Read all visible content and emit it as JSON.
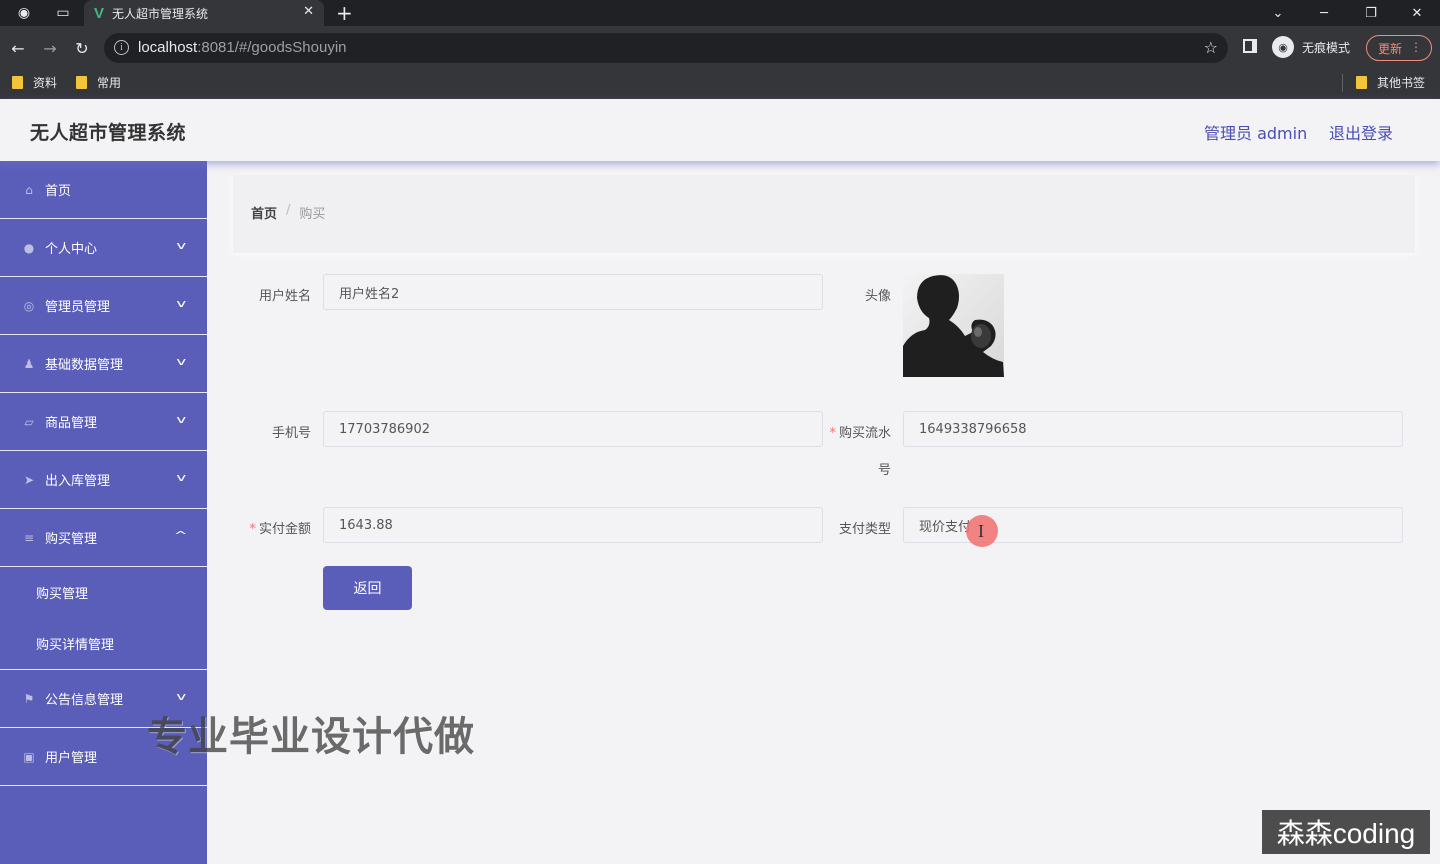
{
  "browser": {
    "tab_title": "无人超市管理系统",
    "tab_favicon": "V",
    "url_host": "localhost",
    "url_rest": ":8081/#/goodsShouyin",
    "incognito_label": "无痕模式",
    "update_label": "更新",
    "bookmarks": [
      "资料",
      "常用"
    ],
    "other_bookmarks": "其他书签",
    "icons": [
      "globe-icon",
      "tab-list-icon",
      "close-icon",
      "plus-icon",
      "back-icon",
      "forward-icon",
      "reload-icon",
      "info-icon",
      "star-icon",
      "side-panel-icon",
      "incognito-icon",
      "more-icon",
      "folder-icon"
    ]
  },
  "header": {
    "app_title": "无人超市管理系统",
    "user_label": "管理员 admin",
    "logout_label": "退出登录"
  },
  "sidebar": {
    "items": [
      {
        "label": "首页",
        "icon": "home-icon"
      },
      {
        "label": "个人中心",
        "icon": "user-icon"
      },
      {
        "label": "管理员管理",
        "icon": "admin-icon"
      },
      {
        "label": "基础数据管理",
        "icon": "data-icon"
      },
      {
        "label": "商品管理",
        "icon": "goods-icon"
      },
      {
        "label": "出入库管理",
        "icon": "send-icon"
      },
      {
        "label": "购买管理",
        "icon": "list-icon"
      },
      {
        "label": "公告信息管理",
        "icon": "flag-icon"
      },
      {
        "label": "用户管理",
        "icon": "users-icon"
      }
    ],
    "submenu": [
      "购买管理",
      "购买详情管理"
    ]
  },
  "breadcrumb": {
    "home": "首页",
    "separator": "/",
    "current": "购买"
  },
  "form": {
    "username_label": "用户姓名",
    "username_value": "用户姓名2",
    "avatar_label": "头像",
    "phone_label": "手机号",
    "phone_value": "17703786902",
    "serial_label_1": "购买流水",
    "serial_label_2": "号",
    "serial_value": "1649338796658",
    "amount_label": "实付金额",
    "amount_value": "1643.88",
    "paytype_label": "支付类型",
    "paytype_value": "现价支付",
    "required_mark": "*",
    "back_button": "返回"
  },
  "overlay": {
    "watermark": "专业毕业设计代做",
    "brand": "森森coding"
  },
  "colors": {
    "sidebar": "#5b5eb9",
    "accent_text": "#4a4db3",
    "required": "#f56c6c"
  }
}
